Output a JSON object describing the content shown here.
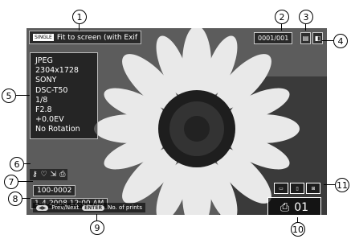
{
  "header": {
    "mode_badge": "SINGLE",
    "display_mode": "Fit to screen (with Exif"
  },
  "counter": "0001/001",
  "exif": {
    "lines": [
      "JPEG",
      "2304x1728",
      "SONY",
      "DSC-T50",
      "1/8",
      "F2.8",
      "+0.0EV",
      "No Rotation"
    ]
  },
  "file_number": "100-0002",
  "datetime": "1-4-2008 12:00 AM",
  "help": {
    "nav_key": "◀▶",
    "nav_label": "Prev/Next",
    "enter_key": "ENTER",
    "enter_label": "No. of prints"
  },
  "prints": {
    "icon": "print-icon",
    "count": "01"
  },
  "callouts": [
    "1",
    "2",
    "3",
    "4",
    "5",
    "6",
    "7",
    "8",
    "9",
    "10",
    "11"
  ]
}
